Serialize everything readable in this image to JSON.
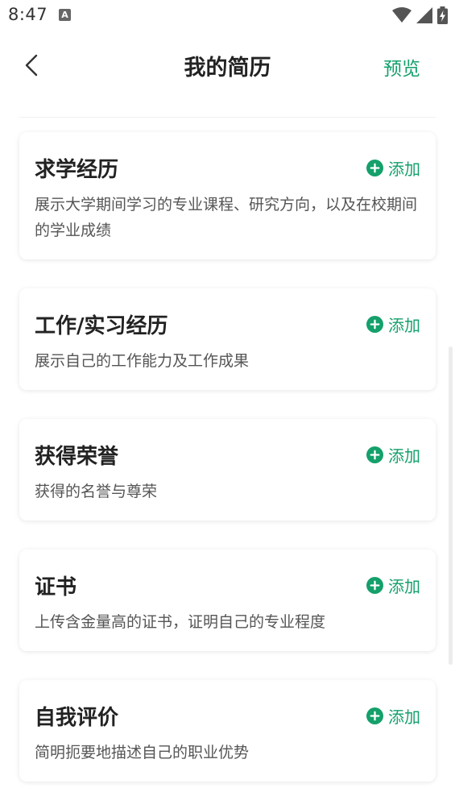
{
  "status_bar": {
    "time": "8:47",
    "notification_icon": "a-icon",
    "wifi_icon": "wifi-icon",
    "signal_icon": "signal-icon",
    "battery_icon": "battery-charging-icon"
  },
  "header": {
    "back_icon": "chevron-left-icon",
    "title": "我的简历",
    "preview_label": "预览"
  },
  "colors": {
    "accent": "#14a06b",
    "title_text": "#222222",
    "desc_text": "#555555"
  },
  "sections": [
    {
      "title": "求学经历",
      "add_label": "添加",
      "description": "展示大学期间学习的专业课程、研究方向，以及在校期间的学业成绩"
    },
    {
      "title": "工作/实习经历",
      "add_label": "添加",
      "description": "展示自己的工作能力及工作成果"
    },
    {
      "title": "获得荣誉",
      "add_label": "添加",
      "description": "获得的名誉与尊荣"
    },
    {
      "title": "证书",
      "add_label": "添加",
      "description": "上传含金量高的证书，证明自己的专业程度"
    },
    {
      "title": "自我评价",
      "add_label": "添加",
      "description": "简明扼要地描述自己的职业优势"
    }
  ]
}
